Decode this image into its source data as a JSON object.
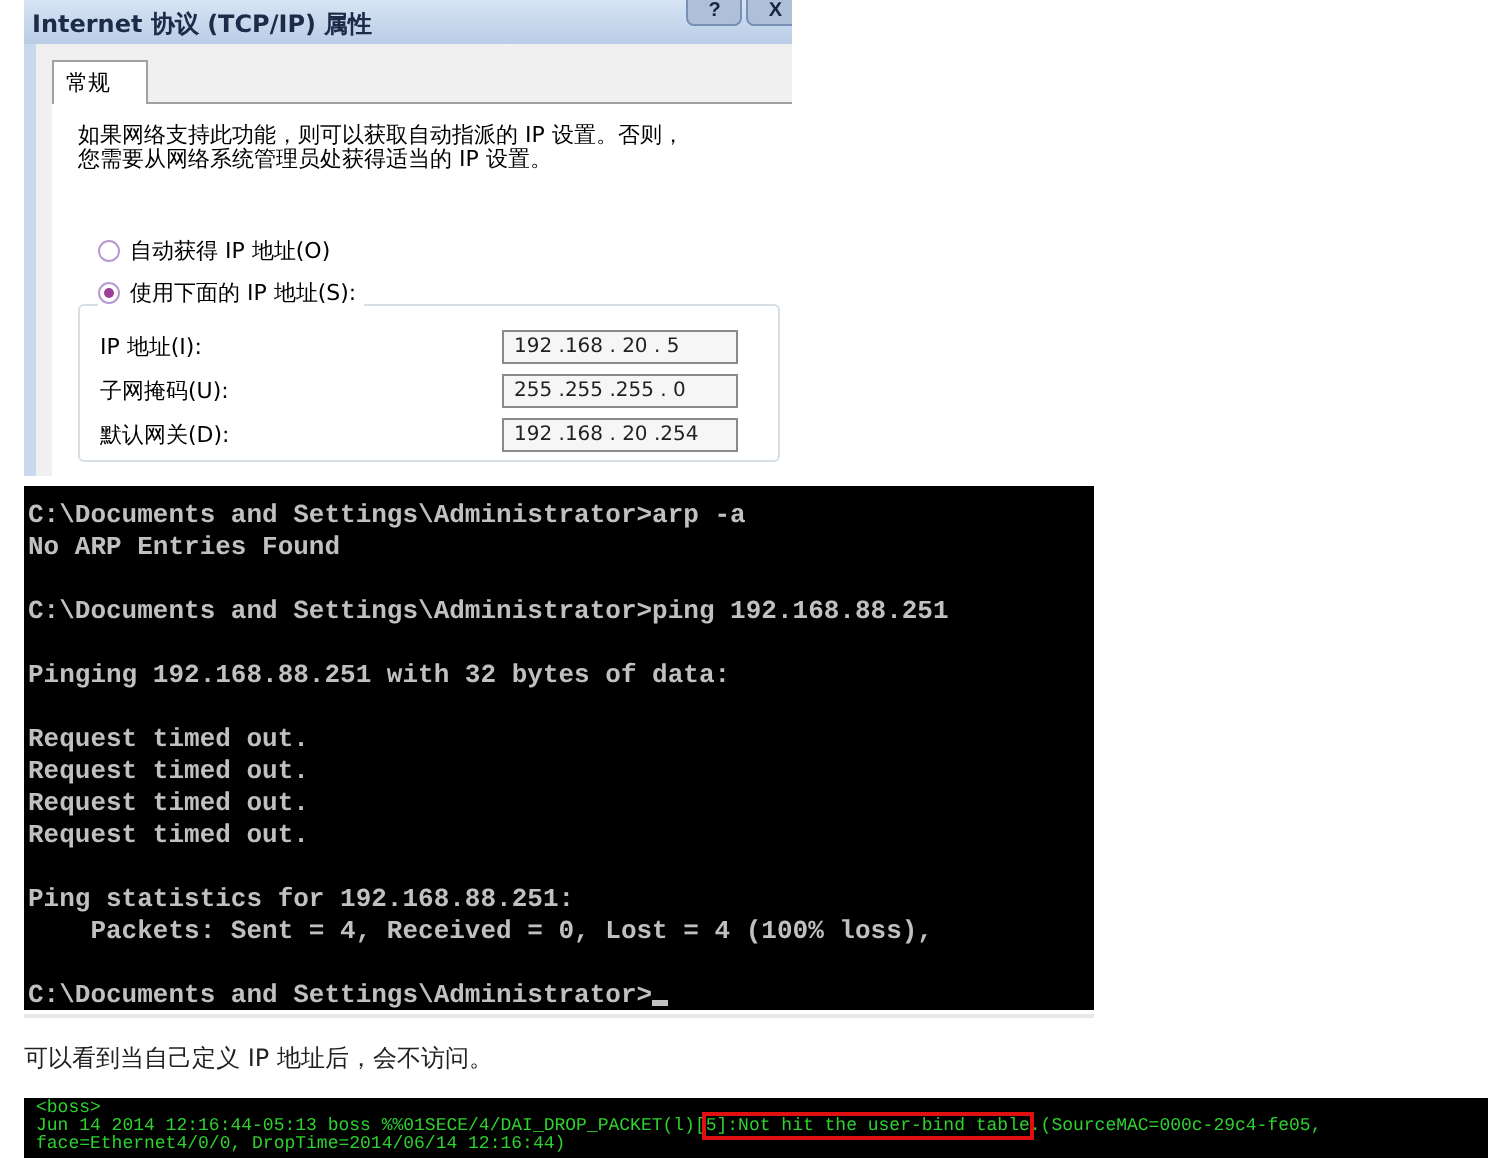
{
  "dialog": {
    "title": "Internet 协议 (TCP/IP) 属性",
    "title_buttons": [
      "?",
      "X"
    ],
    "tabs": [
      {
        "label": "常规",
        "selected": true
      }
    ],
    "description": [
      "如果网络支持此功能，则可以获取自动指派的 IP 设置。否则，",
      "您需要从网络系统管理员处获得适当的 IP 设置。"
    ],
    "options": [
      {
        "label": "自动获得 IP 地址(O)",
        "selected": false
      },
      {
        "label": "使用下面的 IP 地址(S):",
        "selected": true
      }
    ],
    "fields": [
      {
        "label": "IP 地址(I):",
        "value": "192 .168 . 20 . 5"
      },
      {
        "label": "子网掩码(U):",
        "value": "255 .255 .255 . 0"
      },
      {
        "label": "默认网关(D):",
        "value": "192 .168 . 20 .254"
      }
    ]
  },
  "console": {
    "blocks": [
      [
        "C:\\Documents and Settings\\Administrator>arp -a",
        "No ARP Entries Found"
      ],
      [
        "C:\\Documents and Settings\\Administrator>ping 192.168.88.251"
      ],
      [
        "Pinging 192.168.88.251 with 32 bytes of data:"
      ],
      [
        "Request timed out.",
        "Request timed out.",
        "Request timed out.",
        "Request timed out."
      ],
      [
        "Ping statistics for 192.168.88.251:",
        "    Packets: Sent = 4, Received = 0, Lost = 4 (100% loss),"
      ],
      [
        "C:\\Documents and Settings\\Administrator>"
      ]
    ],
    "cursor": true
  },
  "caption": "可以看到当自己定义 IP 地址后，会不访问。",
  "log": {
    "lines": [
      [
        {
          "text": "<boss>",
          "highlighted": false
        }
      ],
      [
        {
          "text": "Jun 14 2014 12:16:44-05:13 boss %%01SECE/4/DAI_DROP_PACKET(l)[",
          "highlighted": false
        },
        {
          "text": "5]:Not hit the user-bind table",
          "highlighted": true
        },
        {
          "text": ".(SourceMAC=000c-29c4-fe05,",
          "highlighted": false
        }
      ],
      [
        {
          "text": "face=Ethernet4/0/0, DropTime=2014/06/14 12:16:44)",
          "highlighted": false
        }
      ]
    ]
  }
}
